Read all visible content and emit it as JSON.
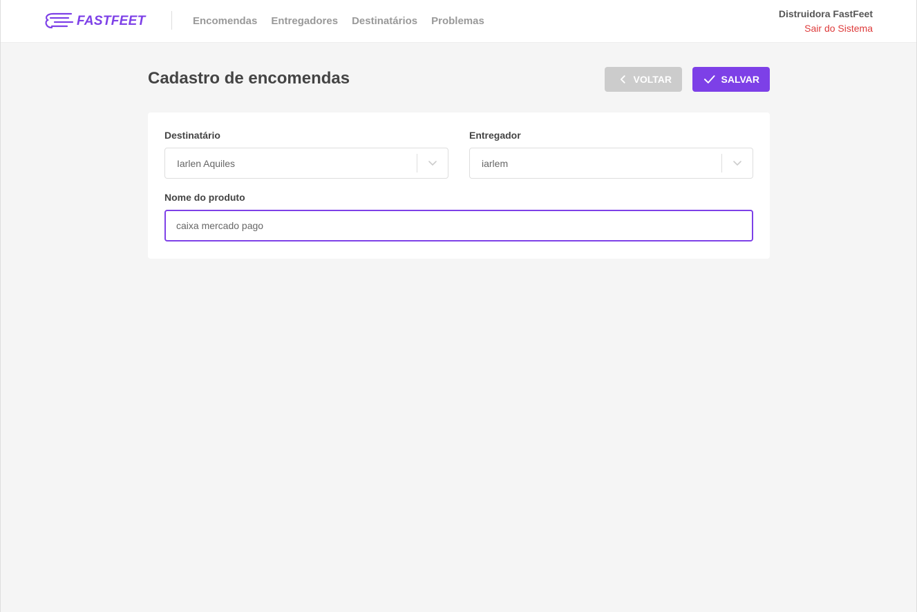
{
  "brand": {
    "name": "FASTFEET",
    "color": "#7d40e7"
  },
  "nav": [
    {
      "label": "Encomendas"
    },
    {
      "label": "Entregadores"
    },
    {
      "label": "Destinatários"
    },
    {
      "label": "Problemas"
    }
  ],
  "profile": {
    "name": "Distruidora FastFeet",
    "logout": "Sair do Sistema",
    "logout_color": "#de3b3b"
  },
  "page": {
    "title": "Cadastro de encomendas",
    "back_label": "VOLTAR",
    "back_icon": "chevron-left-icon",
    "save_label": "SALVAR",
    "save_icon": "check-icon"
  },
  "form": {
    "recipient": {
      "label": "Destinatário",
      "value": "Iarlen Aquiles"
    },
    "deliveryman": {
      "label": "Entregador",
      "value": "iarlem"
    },
    "product": {
      "label": "Nome do produto",
      "value": "caixa mercado pago"
    }
  }
}
